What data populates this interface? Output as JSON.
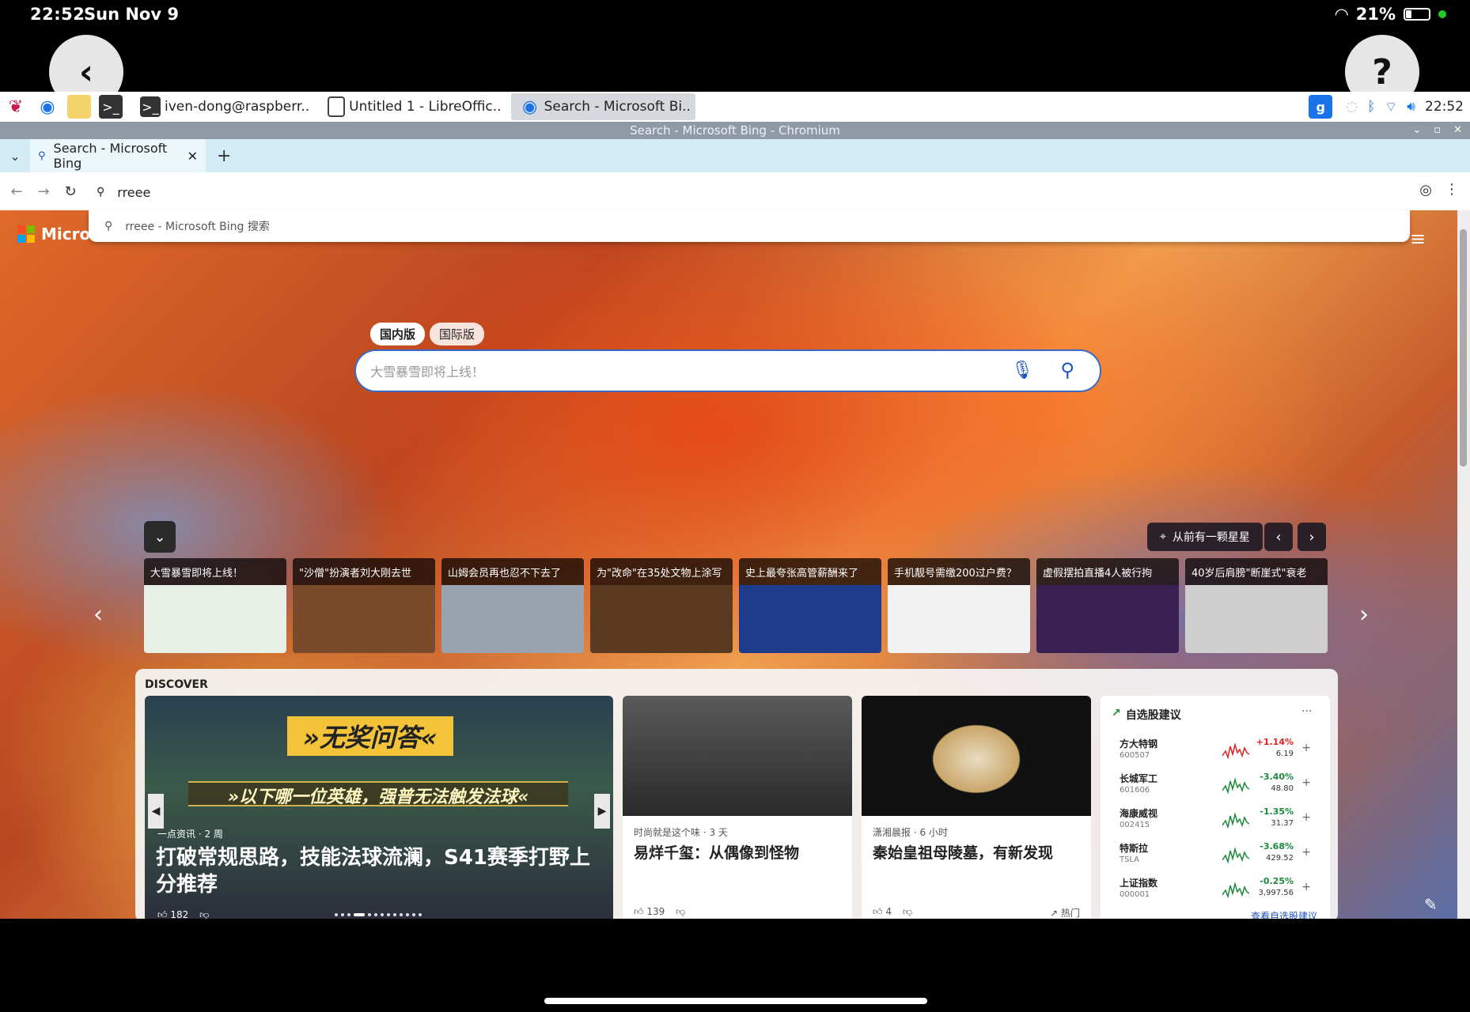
{
  "ios": {
    "time": "22:52",
    "date": "Sun Nov 9",
    "battery": "21%"
  },
  "overlay": {
    "back_glyph": "‹",
    "help_glyph": "?"
  },
  "taskbar": {
    "tasks": [
      {
        "label": "iven-dong@raspberr.."
      },
      {
        "label": "Untitled 1 - LibreOffic.."
      },
      {
        "label": "Search - Microsoft Bi.."
      }
    ],
    "clock": "22:52",
    "g_label": "g"
  },
  "window": {
    "title": "Search - Microsoft Bing - Chromium"
  },
  "browser": {
    "tab_title": "Search - Microsoft Bing",
    "omnibox_value": "rreee",
    "suggestion": "rreee - Microsoft Bing 搜索"
  },
  "bing": {
    "logo_text": "Micros",
    "version_tabs": [
      "国内版",
      "国际版"
    ],
    "search_placeholder": "大雪暴雪即将上线！",
    "location": "从前有一颗星星",
    "news": [
      {
        "title": "大雪暴雪即将上线！",
        "color": "#e8efe6"
      },
      {
        "title": "\"沙僧\"扮演者刘大刚去世",
        "color": "#7a4a2a"
      },
      {
        "title": "山姆会员再也忍不下去了",
        "color": "#9aa4b0"
      },
      {
        "title": "为\"改命\"在35处文物上涂写",
        "color": "#5a3a20"
      },
      {
        "title": "史上最夸张高管薪酬来了",
        "color": "#1e3a8a"
      },
      {
        "title": "手机靓号需缴200过户费？",
        "color": "#f2f2f2"
      },
      {
        "title": "虚假摆拍直播4人被行拘",
        "color": "#3a2050"
      },
      {
        "title": "40岁后肩膀\"断崖式\"衰老",
        "color": "#cfcfcf"
      }
    ],
    "discover": {
      "label": "DISCOVER",
      "hero": {
        "banner1": "»无奖问答«",
        "banner2": "»以下哪一位英雄，强普无法触发法球«",
        "source": "一点资讯 · 2 周",
        "title": "打破常规思路，技能法球流澜，S41赛季打野上分推荐",
        "likes": "182"
      },
      "cards": [
        {
          "source": "时尚就是这个味 · 3 天",
          "title": "易烊千玺：从偶像到怪物",
          "likes": "139",
          "tag": ""
        },
        {
          "source": "潇湘晨报 · 6 小时",
          "title": "秦始皇祖母陵墓，有新发现",
          "likes": "4",
          "tag": "热门"
        }
      ],
      "stocks": {
        "title": "自选股建议",
        "more": "···",
        "link": "查看自选股建议",
        "items": [
          {
            "name": "方大特钢",
            "code": "600507",
            "change": "+1.14%",
            "price": "6.19",
            "color": "#d22"
          },
          {
            "name": "长城军工",
            "code": "601606",
            "change": "-3.40%",
            "price": "48.80",
            "color": "#1a8a3a"
          },
          {
            "name": "海康威视",
            "code": "002415",
            "change": "-1.35%",
            "price": "31.37",
            "color": "#1a8a3a"
          },
          {
            "name": "特斯拉",
            "code": "TSLA",
            "change": "-3.68%",
            "price": "429.52",
            "color": "#1a8a3a"
          },
          {
            "name": "上证指数",
            "code": "000001",
            "change": "-0.25%",
            "price": "3,997.56",
            "color": "#1a8a3a"
          }
        ]
      }
    }
  }
}
